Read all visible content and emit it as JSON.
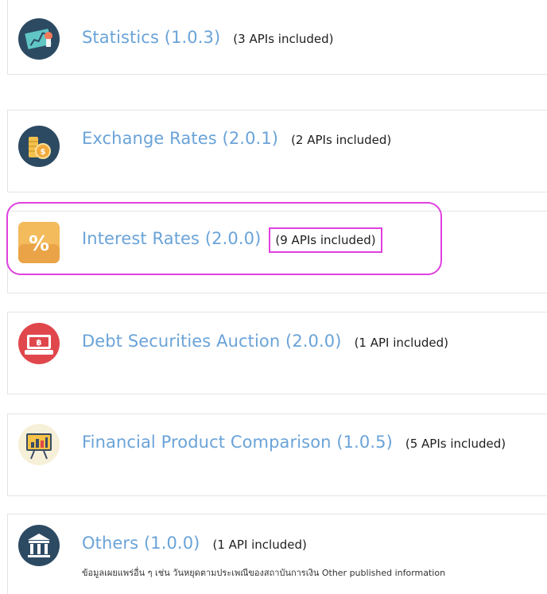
{
  "categories": [
    {
      "title": "Statistics (1.0.3)",
      "count": "(3 APIs included)",
      "icon": "statistics-chart-icon"
    },
    {
      "title": "Exchange Rates (2.0.1)",
      "count": "(2 APIs included)",
      "icon": "coin-stack-icon"
    },
    {
      "title": "Interest Rates (2.0.0)",
      "count": "(9 APIs included)",
      "icon": "percent-icon"
    },
    {
      "title": "Debt Securities Auction (2.0.0)",
      "count": "(1 API included)",
      "icon": "baht-certificate-icon"
    },
    {
      "title": "Financial Product Comparison (1.0.5)",
      "count": "(5 APIs included)",
      "icon": "presentation-board-icon"
    },
    {
      "title": "Others (1.0.0)",
      "count": "(1 API included)",
      "icon": "bank-building-icon",
      "description": "ข้อมูลเผยแพร่อื่น ๆ เช่น วันหยุดตามประเพณีของสถาบันการเงิน Other published information"
    }
  ],
  "colors": {
    "title": "#6aa3d8",
    "highlight": "#e040e0",
    "card_border": "#e4e4e4"
  }
}
